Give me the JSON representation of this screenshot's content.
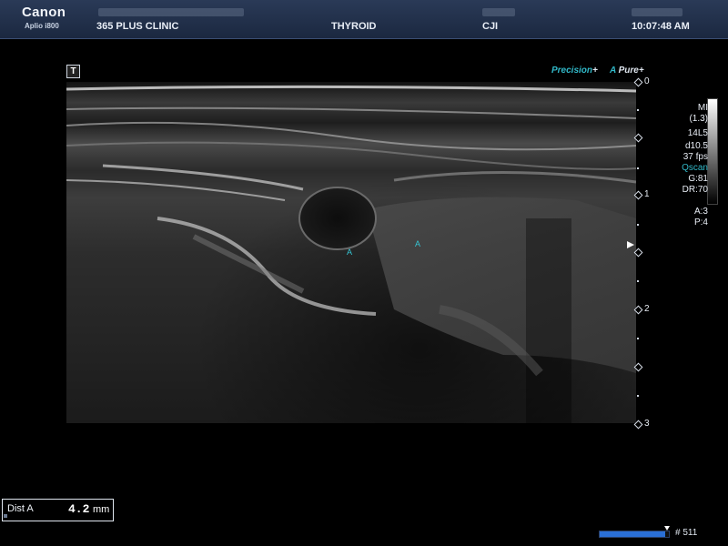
{
  "header": {
    "brand": "Canon",
    "model": "Aplio i800",
    "clinic": "365 PLUS CLINIC",
    "exam": "THYROID",
    "operator": "CJI",
    "time": "10:07:48 AM"
  },
  "image": {
    "mode_icon": "T",
    "precision_label": "Precision",
    "precision_plus": "+",
    "apure_prefix": "A",
    "apure_label": "Pure",
    "apure_plus": "+"
  },
  "depth_scale": {
    "labels": [
      "0",
      "1",
      "2",
      "3"
    ]
  },
  "params": {
    "mi_label": "MI",
    "mi_value": "(1.3)",
    "probe": "14L5",
    "depth": "d10.5",
    "fps": "37 fps",
    "qscan": "Qscan",
    "gain": "G:81",
    "dynamic_range": "DR:70",
    "a_value": "A:3",
    "p_value": "P:4"
  },
  "measurement": {
    "label": "Dist A",
    "value": "4.2",
    "unit": "mm",
    "marker_a": "A",
    "marker_b": "A"
  },
  "cine": {
    "frame_label": "# 511",
    "progress": 0.95,
    "bar_color": "#2a6fd6"
  },
  "colors": {
    "header_bg": "#1f2d48",
    "accent_cyan": "#31b8c8"
  }
}
